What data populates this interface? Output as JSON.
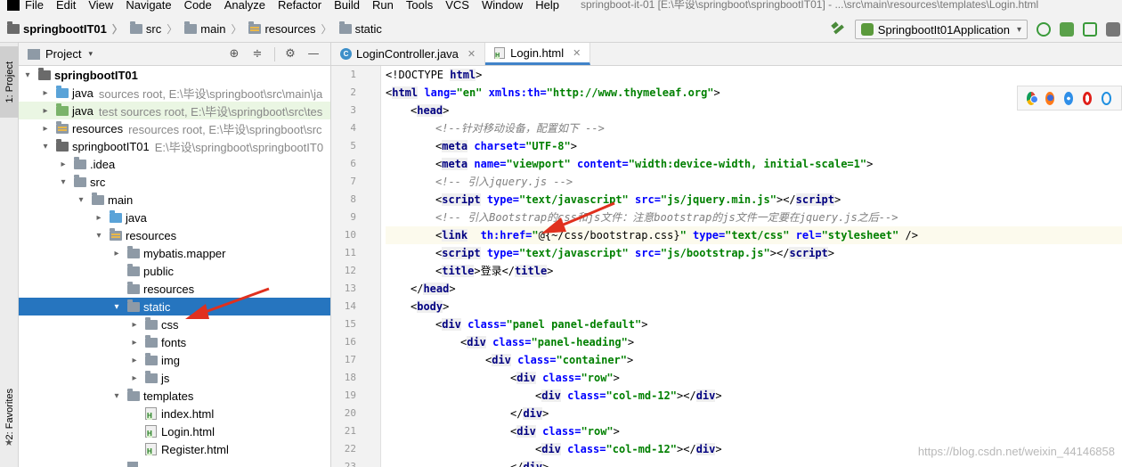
{
  "menu": [
    "File",
    "Edit",
    "View",
    "Navigate",
    "Code",
    "Analyze",
    "Refactor",
    "Build",
    "Run",
    "Tools",
    "VCS",
    "Window",
    "Help"
  ],
  "window_title": "springboot-it-01 [E:\\毕设\\springboot\\springbootIT01] - ...\\src\\main\\resources\\templates\\Login.html",
  "breadcrumb": [
    "springbootIT01",
    "src",
    "main",
    "resources",
    "static"
  ],
  "run_config": "SpringbootIt01Application",
  "sidebar": {
    "project_tab": "1: Project",
    "favorites_tab": "2: Favorites"
  },
  "project_panel": {
    "title": "Project"
  },
  "tree": [
    {
      "level": 0,
      "arrow": "▾",
      "icon": "dark",
      "label": "springbootIT01",
      "bold": true
    },
    {
      "level": 1,
      "arrow": "▸",
      "icon": "blue",
      "label": "java",
      "meta": "sources root,  E:\\毕设\\springboot\\src\\main\\ja"
    },
    {
      "level": 1,
      "arrow": "▸",
      "icon": "green",
      "label": "java",
      "meta": "test sources root,  E:\\毕设\\springboot\\src\\tes",
      "green": true
    },
    {
      "level": 1,
      "arrow": "▸",
      "icon": "res",
      "label": "resources",
      "meta": "resources root,  E:\\毕设\\springboot\\src"
    },
    {
      "level": 1,
      "arrow": "▾",
      "icon": "dark",
      "label": "springbootIT01",
      "meta": "E:\\毕设\\springboot\\springbootIT0"
    },
    {
      "level": 2,
      "arrow": "▸",
      "icon": "gray",
      "label": ".idea"
    },
    {
      "level": 2,
      "arrow": "▾",
      "icon": "gray",
      "label": "src"
    },
    {
      "level": 3,
      "arrow": "▾",
      "icon": "gray",
      "label": "main"
    },
    {
      "level": 4,
      "arrow": "▸",
      "icon": "blue",
      "label": "java"
    },
    {
      "level": 4,
      "arrow": "▾",
      "icon": "res",
      "label": "resources"
    },
    {
      "level": 5,
      "arrow": "▸",
      "icon": "gray",
      "label": "mybatis.mapper"
    },
    {
      "level": 5,
      "arrow": "",
      "icon": "gray",
      "label": "public"
    },
    {
      "level": 5,
      "arrow": "",
      "icon": "gray",
      "label": "resources"
    },
    {
      "level": 5,
      "arrow": "▾",
      "icon": "gray",
      "label": "static",
      "selected": true
    },
    {
      "level": 6,
      "arrow": "▸",
      "icon": "gray",
      "label": "css"
    },
    {
      "level": 6,
      "arrow": "▸",
      "icon": "gray",
      "label": "fonts"
    },
    {
      "level": 6,
      "arrow": "▸",
      "icon": "gray",
      "label": "img"
    },
    {
      "level": 6,
      "arrow": "▸",
      "icon": "gray",
      "label": "js"
    },
    {
      "level": 5,
      "arrow": "▾",
      "icon": "gray",
      "label": "templates"
    },
    {
      "level": 6,
      "arrow": "",
      "icon": "html",
      "label": "index.html"
    },
    {
      "level": 6,
      "arrow": "",
      "icon": "html",
      "label": "Login.html"
    },
    {
      "level": 6,
      "arrow": "",
      "icon": "html",
      "label": "Register.html"
    },
    {
      "level": 5,
      "arrow": "",
      "icon": "cut",
      "label": ""
    }
  ],
  "tabs": [
    {
      "label": "LoginController.java",
      "icon": "java",
      "active": false
    },
    {
      "label": "Login.html",
      "icon": "html",
      "active": true
    }
  ],
  "code_lines": [
    {
      "n": "1",
      "indent": 0,
      "parts": [
        [
          "tx",
          "<!DOCTYPE "
        ],
        [
          "tg",
          "html"
        ],
        [
          "tx",
          ">"
        ]
      ]
    },
    {
      "n": "2",
      "indent": 0,
      "parts": [
        [
          "tx",
          "<"
        ],
        [
          "tg",
          "html"
        ],
        [
          "tx",
          " "
        ],
        [
          "an",
          "lang="
        ],
        [
          "av",
          "\"en\""
        ],
        [
          "tx",
          " "
        ],
        [
          "an",
          "xmlns:th="
        ],
        [
          "av",
          "\"http://www.thymeleaf.org\""
        ],
        [
          "tx",
          ">"
        ]
      ]
    },
    {
      "n": "3",
      "indent": 1,
      "parts": [
        [
          "tx",
          "<"
        ],
        [
          "tg",
          "head"
        ],
        [
          "tx",
          ">"
        ]
      ]
    },
    {
      "n": "4",
      "indent": 2,
      "parts": [
        [
          "cm",
          "<!--针对移动设备，配置如下 -->"
        ]
      ]
    },
    {
      "n": "5",
      "indent": 2,
      "parts": [
        [
          "tx",
          "<"
        ],
        [
          "tg",
          "meta"
        ],
        [
          "tx",
          " "
        ],
        [
          "an",
          "charset="
        ],
        [
          "av",
          "\"UTF-8\""
        ],
        [
          "tx",
          ">"
        ]
      ]
    },
    {
      "n": "6",
      "indent": 2,
      "parts": [
        [
          "tx",
          "<"
        ],
        [
          "tg",
          "meta"
        ],
        [
          "tx",
          " "
        ],
        [
          "an",
          "name="
        ],
        [
          "av",
          "\"viewport\""
        ],
        [
          "tx",
          " "
        ],
        [
          "an",
          "content="
        ],
        [
          "av",
          "\"width:device-width, initial-scale=1\""
        ],
        [
          "tx",
          ">"
        ]
      ]
    },
    {
      "n": "7",
      "indent": 2,
      "parts": [
        [
          "cm",
          "<!-- 引入jquery.js -->"
        ]
      ]
    },
    {
      "n": "8",
      "indent": 2,
      "parts": [
        [
          "tx",
          "<"
        ],
        [
          "tg",
          "script"
        ],
        [
          "tx",
          " "
        ],
        [
          "an",
          "type="
        ],
        [
          "av",
          "\"text/javascript\""
        ],
        [
          "tx",
          " "
        ],
        [
          "an",
          "src="
        ],
        [
          "av",
          "\"js/jquery.min.js\""
        ],
        [
          "tx",
          "></"
        ],
        [
          "tg",
          "script"
        ],
        [
          "tx",
          ">"
        ]
      ]
    },
    {
      "n": "9",
      "indent": 2,
      "parts": [
        [
          "cm",
          "<!-- 引入Bootstrap的css和js文件：注意bootstrap的js文件一定要在jquery.js之后-->"
        ]
      ]
    },
    {
      "n": "10",
      "indent": 2,
      "hl": true,
      "parts": [
        [
          "tx",
          "<"
        ],
        [
          "tg",
          "link"
        ],
        [
          "tx",
          "  "
        ],
        [
          "an",
          "th:href="
        ],
        [
          "av",
          "\""
        ],
        [
          "tx",
          "@{~/css/bootstrap.css}"
        ],
        [
          "av",
          "\""
        ],
        [
          "tx",
          " "
        ],
        [
          "an",
          "type="
        ],
        [
          "av",
          "\"text/css\""
        ],
        [
          "tx",
          " "
        ],
        [
          "an",
          "rel="
        ],
        [
          "av",
          "\"stylesheet\""
        ],
        [
          "tx",
          " />"
        ]
      ]
    },
    {
      "n": "11",
      "indent": 2,
      "parts": [
        [
          "tx",
          "<"
        ],
        [
          "tg",
          "script"
        ],
        [
          "tx",
          " "
        ],
        [
          "an",
          "type="
        ],
        [
          "av",
          "\"text/javascript\""
        ],
        [
          "tx",
          " "
        ],
        [
          "an",
          "src="
        ],
        [
          "av",
          "\"js/bootstrap.js\""
        ],
        [
          "tx",
          "></"
        ],
        [
          "tg",
          "script"
        ],
        [
          "tx",
          ">"
        ]
      ]
    },
    {
      "n": "12",
      "indent": 2,
      "parts": [
        [
          "tx",
          "<"
        ],
        [
          "tg",
          "title"
        ],
        [
          "tx",
          ">登录</"
        ],
        [
          "tg",
          "title"
        ],
        [
          "tx",
          ">"
        ]
      ]
    },
    {
      "n": "13",
      "indent": 1,
      "parts": [
        [
          "tx",
          "</"
        ],
        [
          "tg",
          "head"
        ],
        [
          "tx",
          ">"
        ]
      ]
    },
    {
      "n": "14",
      "indent": 1,
      "parts": [
        [
          "tx",
          "<"
        ],
        [
          "tg",
          "body"
        ],
        [
          "tx",
          ">"
        ]
      ]
    },
    {
      "n": "15",
      "indent": 2,
      "parts": [
        [
          "tx",
          "<"
        ],
        [
          "tg",
          "div"
        ],
        [
          "tx",
          " "
        ],
        [
          "an",
          "class="
        ],
        [
          "av",
          "\"panel panel-default\""
        ],
        [
          "tx",
          ">"
        ]
      ]
    },
    {
      "n": "16",
      "indent": 3,
      "parts": [
        [
          "tx",
          "<"
        ],
        [
          "tg",
          "div"
        ],
        [
          "tx",
          " "
        ],
        [
          "an",
          "class="
        ],
        [
          "av",
          "\"panel-heading\""
        ],
        [
          "tx",
          ">"
        ]
      ]
    },
    {
      "n": "17",
      "indent": 4,
      "parts": [
        [
          "tx",
          "<"
        ],
        [
          "tg",
          "div"
        ],
        [
          "tx",
          " "
        ],
        [
          "an",
          "class="
        ],
        [
          "av",
          "\"container\""
        ],
        [
          "tx",
          ">"
        ]
      ]
    },
    {
      "n": "18",
      "indent": 5,
      "parts": [
        [
          "tx",
          "<"
        ],
        [
          "tg",
          "div"
        ],
        [
          "tx",
          " "
        ],
        [
          "an",
          "class="
        ],
        [
          "av",
          "\"row\""
        ],
        [
          "tx",
          ">"
        ]
      ]
    },
    {
      "n": "19",
      "indent": 6,
      "parts": [
        [
          "tx",
          "<"
        ],
        [
          "tg",
          "div"
        ],
        [
          "tx",
          " "
        ],
        [
          "an",
          "class="
        ],
        [
          "av",
          "\"col-md-12\""
        ],
        [
          "tx",
          "></"
        ],
        [
          "tg",
          "div"
        ],
        [
          "tx",
          ">"
        ]
      ]
    },
    {
      "n": "20",
      "indent": 5,
      "parts": [
        [
          "tx",
          "</"
        ],
        [
          "tg",
          "div"
        ],
        [
          "tx",
          ">"
        ]
      ]
    },
    {
      "n": "21",
      "indent": 5,
      "parts": [
        [
          "tx",
          "<"
        ],
        [
          "tg",
          "div"
        ],
        [
          "tx",
          " "
        ],
        [
          "an",
          "class="
        ],
        [
          "av",
          "\"row\""
        ],
        [
          "tx",
          ">"
        ]
      ]
    },
    {
      "n": "22",
      "indent": 6,
      "parts": [
        [
          "tx",
          "<"
        ],
        [
          "tg",
          "div"
        ],
        [
          "tx",
          " "
        ],
        [
          "an",
          "class="
        ],
        [
          "av",
          "\"col-md-12\""
        ],
        [
          "tx",
          "></"
        ],
        [
          "tg",
          "div"
        ],
        [
          "tx",
          ">"
        ]
      ]
    },
    {
      "n": "23",
      "indent": 5,
      "parts": [
        [
          "tx",
          "</"
        ],
        [
          "tg",
          "div"
        ],
        [
          "tx",
          ">"
        ]
      ]
    }
  ],
  "browsers": [
    "chrome-icon",
    "firefox-icon",
    "safari-icon",
    "opera-icon",
    "ie-icon"
  ],
  "watermark": "https://blog.csdn.net/weixin_44146858",
  "colors": {
    "selection": "#2675bf",
    "tag": "#000080",
    "attr": "#0000ff",
    "value": "#008000",
    "comment": "#808080",
    "arrow": "#e0301e"
  }
}
